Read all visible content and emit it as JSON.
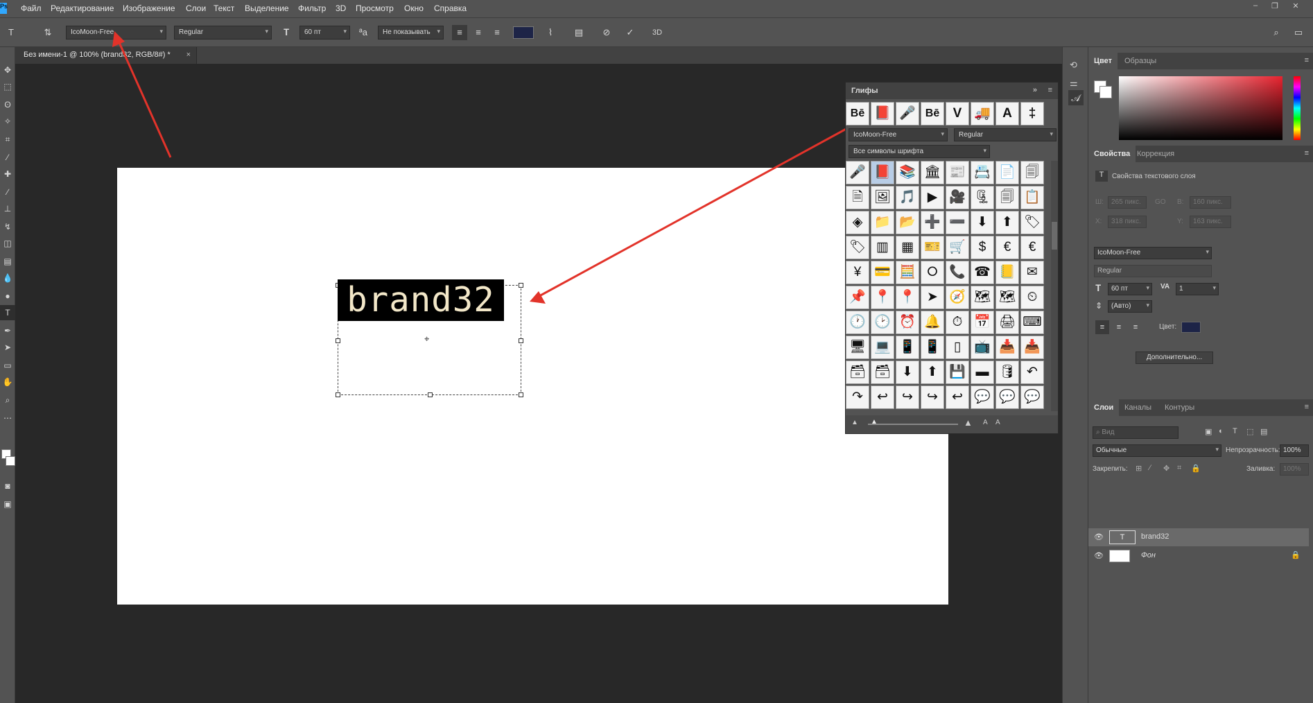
{
  "menubar": {
    "logo": "Ps",
    "items": [
      "Файл",
      "Редактирование",
      "Изображение",
      "Слои",
      "Текст",
      "Выделение",
      "Фильтр",
      "3D",
      "Просмотр",
      "Окно",
      "Справка"
    ]
  },
  "options": {
    "font_family": "IcoMoon-Free",
    "font_style": "Regular",
    "font_size": "60 пт",
    "antialias": "Не показывать",
    "text_color": "#1d2447"
  },
  "document": {
    "tab_title": "Без имени-1 @ 100% (brand32, RGB/8#) *",
    "text": "brand32"
  },
  "glyphs": {
    "title": "Глифы",
    "font_family": "IcoMoon-Free",
    "font_style": "Regular",
    "filter": "Все символы шрифта",
    "recent": [
      "Bē",
      "📕",
      "🎤",
      "Bē",
      "V",
      "🚚",
      "A",
      "‡"
    ],
    "grid": [
      "🎤",
      "📕",
      "📚",
      "🏛",
      "📰",
      "📇",
      "📄",
      "🗐",
      "🗎",
      "🖼",
      "🎵",
      "▶",
      "🎥",
      "🗜",
      "🗐",
      "📋",
      "◈",
      "📁",
      "📂",
      "➕",
      "➖",
      "⬇",
      "⬆",
      "🏷",
      "🏷",
      "▥",
      "▦",
      "🎫",
      "🛒",
      "$",
      "€",
      "€",
      "¥",
      "💳",
      "🧮",
      "⭘",
      "📞",
      "☎",
      "📒",
      "✉",
      "📌",
      "📍",
      "📍",
      "➤",
      "🧭",
      "🗺",
      "🗺",
      "⏲",
      "🕐",
      "🕑",
      "⏰",
      "🔔",
      "⏱",
      "📅",
      "🖨",
      "⌨",
      "🖥",
      "💻",
      "📱",
      "📱",
      "▯",
      "📺",
      "📥",
      "📥",
      "🗃",
      "🗃",
      "⬇",
      "⬆",
      "💾",
      "▬",
      "🛢",
      "↶",
      "↷",
      "↩",
      "↪",
      "↪",
      "↩",
      "💬",
      "💬",
      "💬"
    ]
  },
  "color_panel": {
    "tabs": [
      "Цвет",
      "Образцы"
    ]
  },
  "properties": {
    "tabs": [
      "Свойства",
      "Коррекция"
    ],
    "header": "Свойства текстового слоя",
    "w_label": "Ш:",
    "w_value": "265 пикс.",
    "h_label": "В:",
    "h_value": "160 пикс.",
    "x_label": "X:",
    "x_value": "318 пикс.",
    "y_label": "Y:",
    "y_value": "163 пикс.",
    "link": "GO",
    "font_family": "IcoMoon-Free",
    "font_style": "Regular",
    "size": "60 пт",
    "tracking": "1",
    "leading": "(Авто)",
    "color_label": "Цвет:",
    "color": "#1d2447",
    "more_button": "Дополнительно..."
  },
  "layers": {
    "tabs": [
      "Слои",
      "Каналы",
      "Контуры"
    ],
    "search_placeholder": "Вид",
    "blend": "Обычные",
    "opacity_label": "Непрозрачность:",
    "opacity": "100%",
    "lock_label": "Закрепить:",
    "fill_label": "Заливка:",
    "fill": "100%",
    "items": [
      {
        "name": "brand32",
        "type": "T"
      },
      {
        "name": "Фон",
        "type": "bg"
      }
    ]
  },
  "colors": {
    "annotation_arrow": "#e2332a",
    "ui_bg": "#535353",
    "canvas_bg": "#282828"
  }
}
